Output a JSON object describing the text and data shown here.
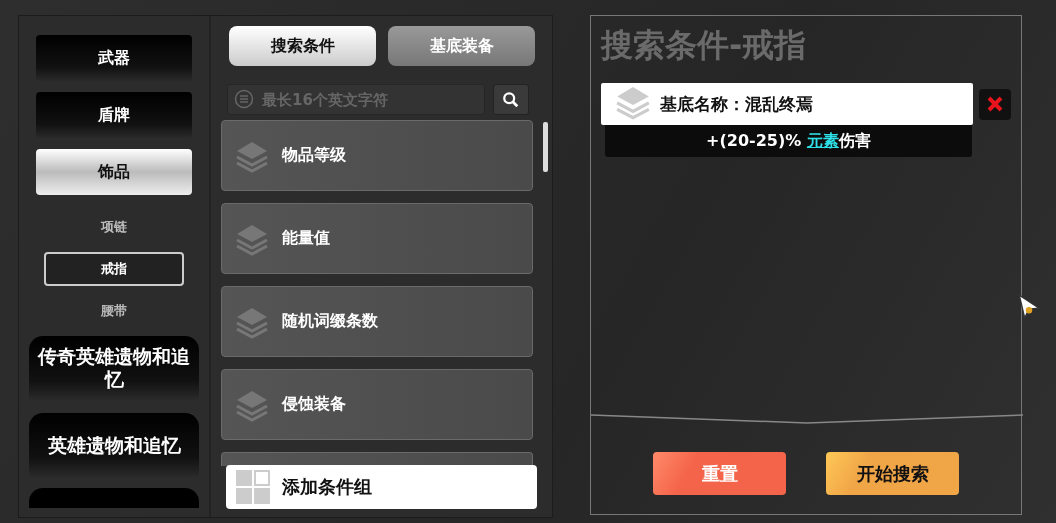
{
  "categories": [
    {
      "label": "武器",
      "selected": false
    },
    {
      "label": "盾牌",
      "selected": false
    },
    {
      "label": "饰品",
      "selected": true,
      "children": [
        {
          "label": "项链",
          "selected": false
        },
        {
          "label": "戒指",
          "selected": true
        },
        {
          "label": "腰带",
          "selected": false
        }
      ]
    },
    {
      "label": "传奇英雄遗物和追忆",
      "selected": false
    },
    {
      "label": "英雄遗物和追忆",
      "selected": false
    }
  ],
  "tabs": [
    {
      "label": "搜索条件",
      "selected": true
    },
    {
      "label": "基底装备",
      "selected": false
    }
  ],
  "search": {
    "placeholder": "最长16个英文字符"
  },
  "conditions": [
    {
      "label": "物品等级"
    },
    {
      "label": "能量值"
    },
    {
      "label": "随机词缀条数"
    },
    {
      "label": "侵蚀装备"
    }
  ],
  "add_button": "添加条件组",
  "panel": {
    "title": "搜索条件-戒指",
    "selected_conditions": [
      {
        "label": "基底名称：混乱终焉",
        "affix": {
          "before": "+(20-25)% ",
          "link": "元素",
          "after": "伤害"
        }
      }
    ],
    "buttons": [
      {
        "label": "重置",
        "kind": "reset"
      },
      {
        "label": "开始搜索",
        "kind": "start"
      }
    ]
  }
}
